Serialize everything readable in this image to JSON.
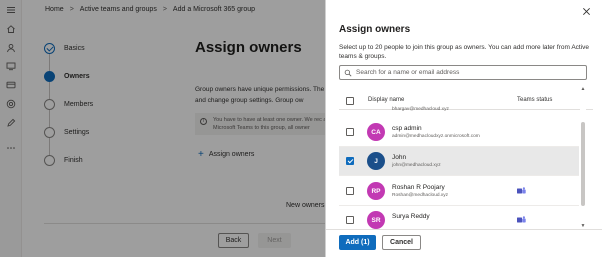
{
  "breadcrumb": {
    "items": [
      "Home",
      "Active teams and groups",
      "Add a Microsoft 365 group"
    ],
    "separator": ">"
  },
  "wizard": {
    "steps": [
      {
        "label": "Basics",
        "state": "done"
      },
      {
        "label": "Owners",
        "state": "current"
      },
      {
        "label": "Members",
        "state": "pending"
      },
      {
        "label": "Settings",
        "state": "pending"
      },
      {
        "label": "Finish",
        "state": "pending"
      }
    ]
  },
  "main": {
    "title": "Assign owners",
    "description": "Group owners have unique permissions. The inbox, and change group settings. Group ow",
    "info_text": "You have to have at least one owner. We rec add Microsoft Teams to this group, all owner",
    "assign_link": "Assign owners",
    "new_owners_text": "New owners v",
    "back_label": "Back",
    "next_label": "Next"
  },
  "panel": {
    "title": "Assign owners",
    "description": "Select up to 20 people to join this group as owners. You can add more later from Active teams & groups.",
    "search_placeholder": "Search for a name or email address",
    "col_display_name": "Display name",
    "col_teams_status": "Teams status",
    "partial_email": "bhargav@medhacloud.xyz",
    "rows": [
      {
        "initials": "CA",
        "name": "csp admin",
        "email": "admin@medhacloudxyz.onmicrosoft.com",
        "avatar_color": "#c239b3",
        "checked": false,
        "teams": false
      },
      {
        "initials": "J",
        "name": "John",
        "email": "john@medhacloud.xyz",
        "avatar_color": "#1b4f8a",
        "checked": true,
        "teams": false
      },
      {
        "initials": "RP",
        "name": "Roshan R Poojary",
        "email": "Roshan@medhacloud.xyz",
        "avatar_color": "#c239b3",
        "checked": false,
        "teams": true
      },
      {
        "initials": "SR",
        "name": "Surya Reddy",
        "email": "",
        "avatar_color": "#c239b3",
        "checked": false,
        "teams": true
      }
    ],
    "add_label": "Add (1)",
    "cancel_label": "Cancel"
  },
  "colors": {
    "accent": "#0f6cbd",
    "avatar_magenta": "#c239b3",
    "avatar_navy": "#1b4f8a",
    "overlay": "rgba(0,0,0,0.38)"
  }
}
